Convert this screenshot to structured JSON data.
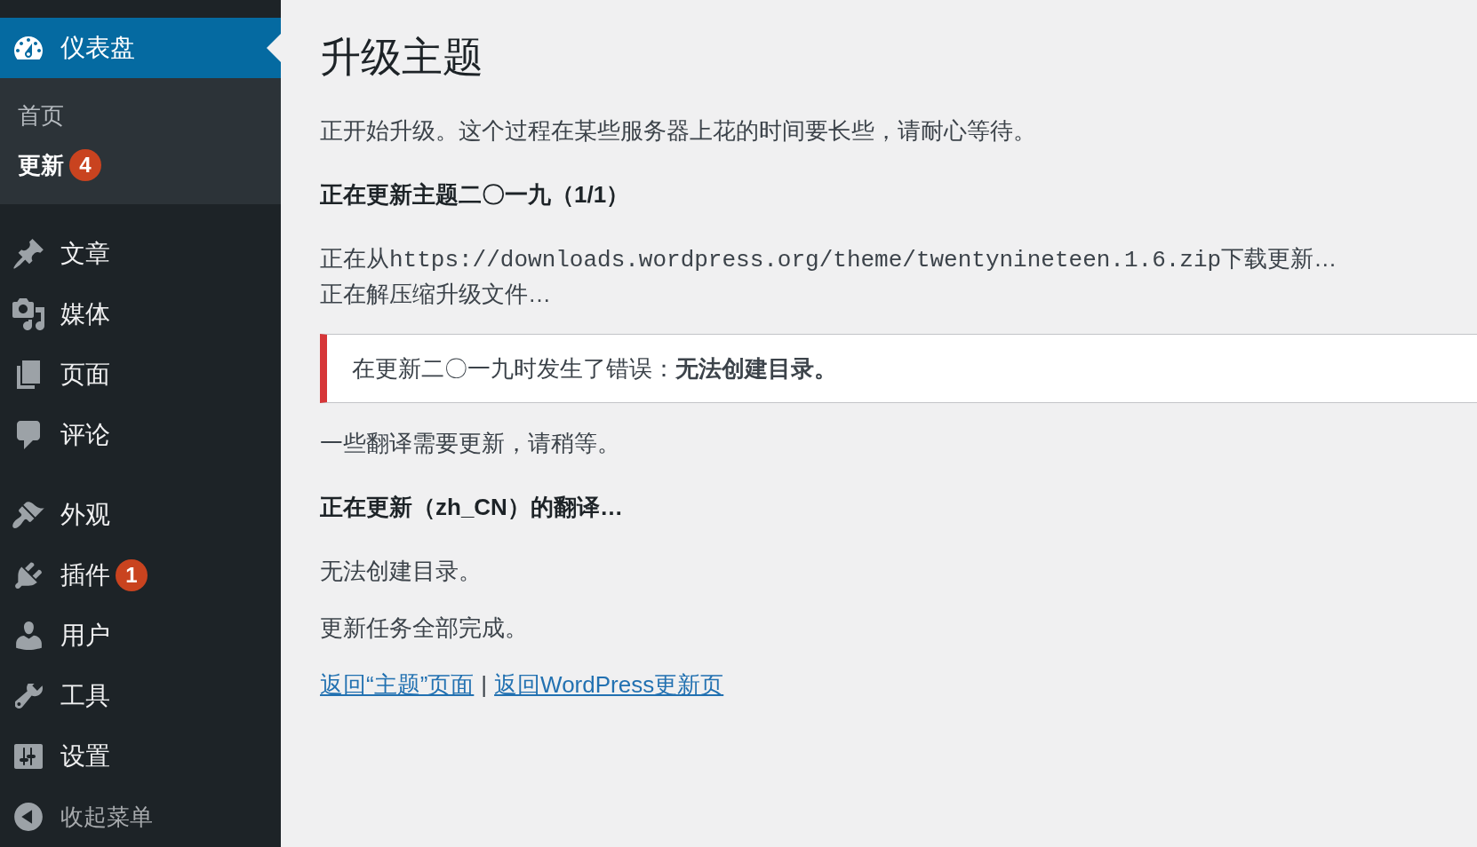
{
  "sidebar": {
    "groups": [
      {
        "items": [
          {
            "label": "仪表盘",
            "selected": true,
            "children": [
              {
                "label": "首页",
                "selected": false
              },
              {
                "label": "更新",
                "selected": true,
                "badge": "4"
              }
            ]
          }
        ]
      },
      {
        "items": [
          {
            "label": "文章",
            "selected": false
          },
          {
            "label": "媒体",
            "selected": false
          },
          {
            "label": "页面",
            "selected": false
          },
          {
            "label": "评论",
            "selected": false
          }
        ]
      },
      {
        "items": [
          {
            "label": "外观",
            "selected": false
          },
          {
            "label": "插件",
            "selected": false,
            "badge": "1"
          },
          {
            "label": "用户",
            "selected": false
          },
          {
            "label": "工具",
            "selected": false
          },
          {
            "label": "设置",
            "selected": false
          }
        ]
      }
    ],
    "collapse_button": {
      "label": "收起菜单"
    }
  },
  "main": {
    "title": "升级主题",
    "blocks": [
      {
        "kind": "paragraph",
        "text": "正开始升级。这个过程在某些服务器上花的时间要长些，请耐心等待。"
      },
      {
        "kind": "heading",
        "text": "正在更新主题二〇一九（1/1）"
      },
      {
        "kind": "log",
        "lines": [
          {
            "before": "正在从",
            "code": "https://downloads.wordpress.org/theme/twentynineteen.1.6.zip",
            "after": "下载更新…"
          },
          {
            "before": "正在解压缩升级文件…"
          }
        ]
      },
      {
        "kind": "error",
        "text": "在更新二〇一九时发生了错误：**无法创建目录。**"
      },
      {
        "kind": "paragraph",
        "text": "一些翻译需要更新，请稍等。"
      },
      {
        "kind": "heading",
        "text": "正在更新（zh_CN）的翻译…"
      },
      {
        "kind": "paragraph",
        "text": "无法创建目录。"
      },
      {
        "kind": "paragraph",
        "text": "更新任务全部完成。"
      },
      {
        "kind": "links",
        "links": [
          "返回“主题”页面",
          "返回WordPress更新页"
        ],
        "separator": "|"
      }
    ]
  }
}
